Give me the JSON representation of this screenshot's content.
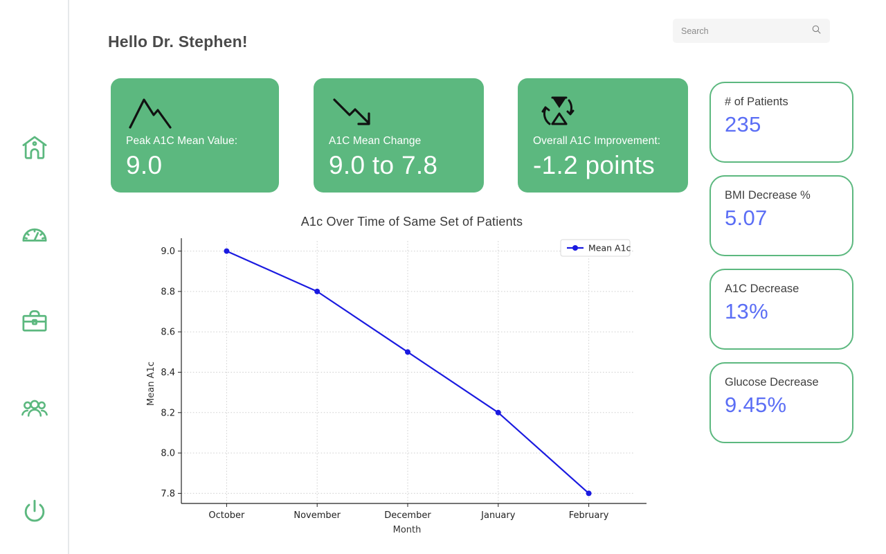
{
  "header": {
    "greeting": "Hello Dr. Stephen!"
  },
  "search": {
    "placeholder": "Search",
    "value": "",
    "icon": "search-icon"
  },
  "sidebar": {
    "items": [
      {
        "name": "home",
        "icon": "home-icon"
      },
      {
        "name": "dashboard",
        "icon": "gauge-icon"
      },
      {
        "name": "cases",
        "icon": "briefcase-icon"
      },
      {
        "name": "patients",
        "icon": "users-icon"
      },
      {
        "name": "logout",
        "icon": "power-icon"
      }
    ]
  },
  "stat_cards": [
    {
      "icon": "mountain-peak-icon",
      "label": "Peak A1C Mean Value:",
      "value": "9.0"
    },
    {
      "icon": "trend-down-icon",
      "label": "A1C Mean Change",
      "value": "9.0 to 7.8"
    },
    {
      "icon": "hourglass-cycle-icon",
      "label": "Overall A1C Improvement:",
      "value": "-1.2 points"
    }
  ],
  "metric_cards": [
    {
      "label": "# of Patients",
      "value": "235"
    },
    {
      "label": "BMI Decrease %",
      "value": "5.07"
    },
    {
      "label": "A1C Decrease",
      "value": "13%"
    },
    {
      "label": "Glucose Decrease",
      "value": "9.45%"
    }
  ],
  "colors": {
    "green": "#5cb87f",
    "blue": "#5b6ef5",
    "line": "#1a1ae0",
    "text_dark": "#3f3f3f",
    "search_bg": "#f5f5f5"
  },
  "chart_data": {
    "type": "line",
    "title": "A1c Over Time of Same Set of Patients",
    "xlabel": "Month",
    "ylabel": "Mean A1c",
    "categories": [
      "October",
      "November",
      "December",
      "January",
      "February"
    ],
    "series": [
      {
        "name": "Mean A1c",
        "values": [
          9.0,
          8.8,
          8.5,
          8.2,
          7.8
        ],
        "color": "#1a1ae0"
      }
    ],
    "yticks": [
      "7.8",
      "8.0",
      "8.2",
      "8.4",
      "8.6",
      "8.8",
      "9.0"
    ],
    "ylim": [
      7.75,
      9.05
    ],
    "grid": true,
    "legend_position": "top-right",
    "legend_entries": [
      "Mean A1c"
    ]
  }
}
